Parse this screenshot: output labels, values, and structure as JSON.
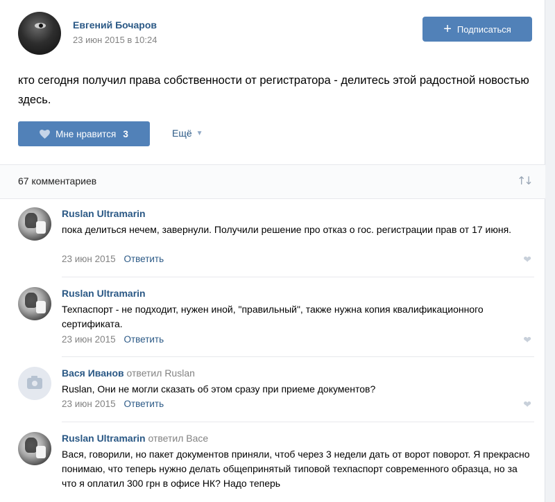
{
  "post": {
    "author": "Евгений Бочаров",
    "date": "23 июн 2015 в 10:24",
    "subscribe_label": "Подписаться",
    "text": "кто сегодня получил права собственности от регистратора - делитесь этой радостной новостью здесь.",
    "like_label": "Мне нравится",
    "like_count": "3",
    "more_label": "Ещё"
  },
  "comments_header": {
    "count_label": "67 комментариев"
  },
  "comments": [
    {
      "author": "Ruslan Ultramarin",
      "reply_to": "",
      "text": "пока делиться нечем, завернули. Получили решение про отказ о гос. регистрации прав от 17 июня.",
      "date": "23 июн 2015",
      "reply_label": "Ответить"
    },
    {
      "author": "Ruslan Ultramarin",
      "reply_to": "",
      "text": "Техпаспорт - не подходит, нужен иной, \"правильный\", также нужна копия квалификационного сертификата.",
      "date": "23 июн 2015",
      "reply_label": "Ответить"
    },
    {
      "author": "Вася Иванов",
      "reply_to": "ответил Ruslan",
      "text": "Ruslan, Они не могли сказать об этом сразу при приеме документов?",
      "date": "23 июн 2015",
      "reply_label": "Ответить"
    },
    {
      "author": "Ruslan Ultramarin",
      "reply_to": "ответил Васе",
      "text": "Вася, говорили, но пакет документов приняли, чтоб через 3 недели дать от ворот поворот. Я прекрасно понимаю, что теперь нужно делать общепринятый типовой техпаспорт современного образца, но за что я оплатил 300 грн в офисе НК? Надо теперь",
      "date": "",
      "reply_label": ""
    }
  ]
}
